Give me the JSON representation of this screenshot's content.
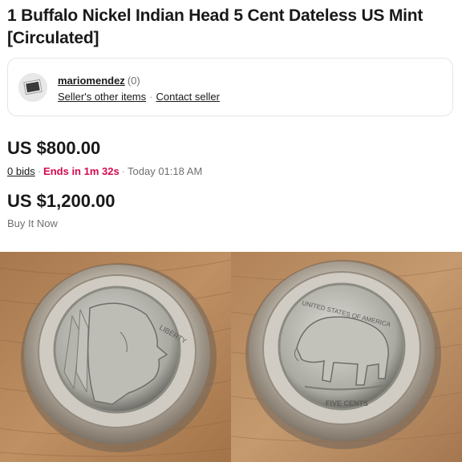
{
  "listing": {
    "title": "1 Buffalo Nickel Indian Head 5 Cent Dateless US Mint [Circulated]"
  },
  "seller": {
    "name": "mariomendez",
    "feedback": "(0)",
    "other_items": "Seller's other items",
    "contact": "Contact seller"
  },
  "auction": {
    "price": "US $800.00",
    "bids": "0 bids",
    "ends": "Ends in 1m 32s",
    "end_time": "Today 01:18 AM"
  },
  "buy_it_now": {
    "price": "US $1,200.00",
    "label": "Buy It Now"
  },
  "images": [
    {
      "icon": "coin-obverse-indian-head-photo",
      "inscription": "LIBERTY"
    },
    {
      "icon": "coin-reverse-buffalo-photo",
      "inscription_top": "UNITED STATES OF AMERICA",
      "inscription_bottom": "FIVE CENTS"
    }
  ]
}
